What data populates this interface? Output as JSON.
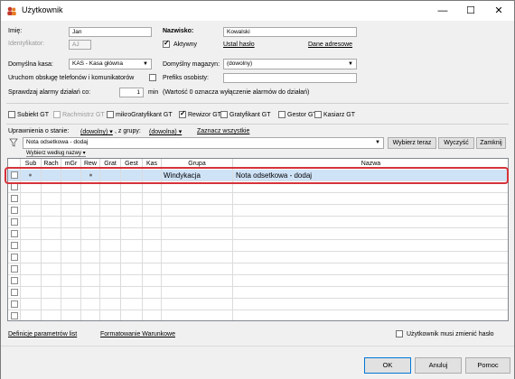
{
  "window": {
    "title": "Użytkownik",
    "minimize": "—",
    "maximize": "☐",
    "close": "✕"
  },
  "form": {
    "imie_label": "Imię:",
    "imie_value": "Jan",
    "nazwisko_label": "Nazwisko:",
    "nazwisko_value": "Kowalski",
    "identyfikator_label": "Identyfikator:",
    "identyfikator_value": "AJ",
    "aktywny_label": "Aktywny",
    "ustal_haslo": "Ustal hasło",
    "dane_adresowe": "Dane adresowe",
    "kasa_label": "Domyślna kasa:",
    "kasa_value": "KAS - Kasa główna",
    "magazyn_label": "Domyślny magazyn:",
    "magazyn_value": "(dowolny)",
    "uruchom_label": "Uruchom obsługę telefonów i komunikatorów",
    "prefiks_label": "Prefiks osobisty:",
    "prefiks_value": "",
    "alarmy_label": "Sprawdzaj alarmy działań co:",
    "alarmy_value": "1",
    "min_label": "min",
    "alarmy_note": "(Wartość 0 oznacza wyłączenie alarmów do działań)"
  },
  "roles": [
    {
      "label": "Subiekt GT",
      "checked": false,
      "disabled": false
    },
    {
      "label": "Rachmistrz GT",
      "checked": false,
      "disabled": true
    },
    {
      "label": "mikroGratyfikant GT",
      "checked": false,
      "disabled": false
    },
    {
      "label": "Rewizor GT",
      "checked": true,
      "disabled": false
    },
    {
      "label": "Gratyfikant GT",
      "checked": false,
      "disabled": false
    },
    {
      "label": "Gestor GT",
      "checked": false,
      "disabled": false
    },
    {
      "label": "Kasiarz GT",
      "checked": false,
      "disabled": false
    }
  ],
  "filters": {
    "uprawnienia_label": "Uprawnienia o stanie:",
    "stan_value": "(dowolny)",
    "grupy_label": ", z grupy:",
    "grupa_value": "(dowolna)",
    "zaznacz": "Zaznacz wszystkie"
  },
  "search": {
    "value": "Nota odsetkowa - dodaj",
    "wybierz_teraz": "Wybierz teraz",
    "wyczysc": "Wyczyść",
    "zamknij": "Zamknij",
    "wybierz_wedlug": "Wybierz według nazwy"
  },
  "grid": {
    "columns": [
      "Sub",
      "Rach",
      "mGr",
      "Rew",
      "Grat",
      "Gest",
      "Kas",
      "Grupa",
      "Nazwa"
    ],
    "selected_row": {
      "sub": "●",
      "rew": "●",
      "grupa": "Windykacja",
      "nazwa": "Nota odsetkowa - dodaj"
    },
    "empty_rows": 13
  },
  "footer": {
    "definicje": "Definicje parametrów list",
    "formatowanie": "Formatowanie Warunkowe",
    "musi_zmienic": "Użytkownik musi zmienić hasło",
    "ok": "OK",
    "anuluj": "Anuluj",
    "pomoc": "Pomoc"
  },
  "colors": {
    "selection": "#cfe3f7",
    "highlight_frame": "#d6323a",
    "accent": "#0078d7"
  }
}
